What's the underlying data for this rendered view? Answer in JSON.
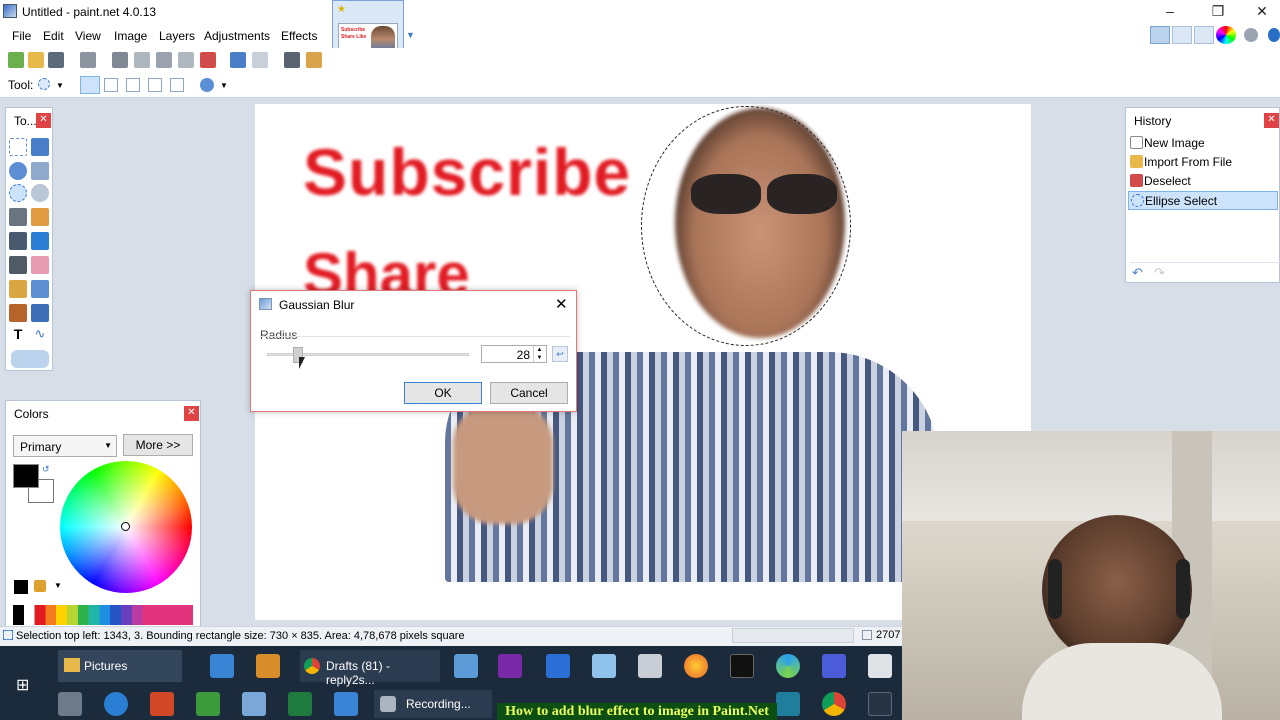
{
  "window": {
    "title": "Untitled - paint.net 4.0.13"
  },
  "menu": [
    "File",
    "Edit",
    "View",
    "Image",
    "Layers",
    "Adjustments",
    "Effects"
  ],
  "toolbar": {
    "tool_label": "Tool:"
  },
  "canvas_text": {
    "line1": "Subscribe",
    "line2": "Share"
  },
  "thumbnail_text": "Subscribe Share Like",
  "tools_panel": {
    "title": "To..."
  },
  "history_panel": {
    "title": "History",
    "items": [
      "New Image",
      "Import From File",
      "Deselect",
      "Ellipse Select"
    ]
  },
  "colors_panel": {
    "title": "Colors",
    "mode": "Primary",
    "more_button": "More >>",
    "primary_color": "#000000",
    "secondary_color": "#ffffff"
  },
  "dialog": {
    "title": "Gaussian Blur",
    "radius_label": "Radius",
    "radius_value": "28",
    "ok": "OK",
    "cancel": "Cancel"
  },
  "status": {
    "selection_text": "Selection top left: 1343, 3. Bounding rectangle size: 730 × 835. Area: 4,78,678 pixels square",
    "coord": "2707"
  },
  "taskbar": {
    "pictures": "Pictures",
    "drafts": "Drafts (81) - reply2s...",
    "recording": "Recording...",
    "banner": "How to add blur effect to image in Paint.Net"
  },
  "accent": "#e21b23"
}
